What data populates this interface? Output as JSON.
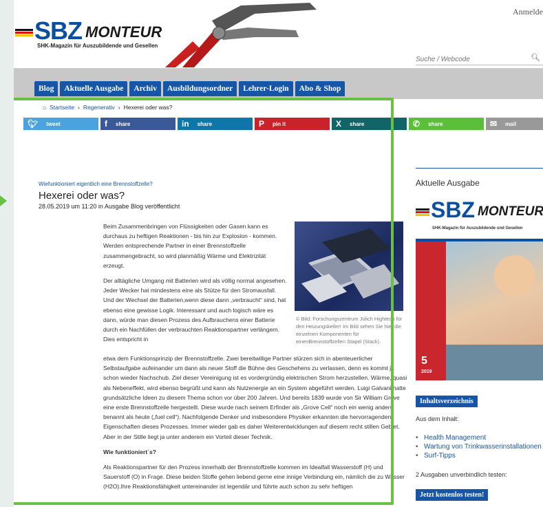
{
  "header": {
    "login": "Anmelde",
    "logo_sbz": "SBZ",
    "logo_monteur": "MONTEUR",
    "logo_tagline": "SHK-Magazin für Auszubildende und Gesellen",
    "search_placeholder": "Suche / Webcode"
  },
  "nav": [
    "Blog",
    "Aktuelle Ausgabe",
    "Archiv",
    "Ausbildungsordner",
    "Lehrer-Login",
    "Abo & Shop"
  ],
  "breadcrumb": {
    "home": "Startseite",
    "section": "Regenerativ",
    "current": "Hexerei oder was?"
  },
  "share": {
    "tweet": "tweet",
    "facebook": "share",
    "linkedin": "share",
    "pinterest": "pin it",
    "xing": "share",
    "whatsapp": "share",
    "mail": "mail",
    "colors": {
      "twitter": "#4aa3df",
      "facebook": "#3b5998",
      "linkedin": "#0e76a8",
      "pinterest": "#c9222b",
      "xing": "#126567",
      "whatsapp": "#5cbf3a",
      "mail": "#999999"
    }
  },
  "article": {
    "kicker": "Wiefunktioniert eigentlich eine Brennstoffzelle?",
    "title": "Hexerei oder was?",
    "date": "28.05.2019 um 11:20 in Ausgabe Blog veröffentlicht",
    "p1": "Beim Zusammenbringen von Flüssigkeiten oder Gasen kann es durchaus zu heftigen Reaktionen - bis hin zur Explosion - kommen. Werden entsprechende Partner in einer Brennstoffzelle zusammengebracht, so wird planmäßig Wärme und Elektrizität erzeugt.",
    "p2a": "Der alltägliche Umgang mit Batterien wird als völlig normal angesehen. Jeder Wecker hat mindestens eine als Stütze für den Stromausfall. Und der Wechsel der Batterien,wenn diese dann „verbraucht“ sind, hat ebenso eine gewisse Logik. Interessant und auch logisch wäre es dann, würde man diesen Prozess des Aufbrauchens einer Batterie durch ein Nachfüllen der verbrauchten Reaktionspartner verlängern. Dies entspricht in",
    "p2b": "etwa dem Funktionsprinzip der Brennstoffzelle. Zwei bereitwillige Partner stürzen sich in abenteuerlicher Selbstaufgabe aufeinander um dann als neuer Stoff die Bühne des Geschehens zu verlassen, denn es kommt ja schon wieder Nachschub. Ziel dieser Vereinigung ist es vordergründig elektrischen Strom herzustellen. Wärme, quasi als Nebeneffekt, wird ebenso begrüßt und kann als Nutzenergie an ein System abgeführt werden. Luigi Galvani hatte grundsätzliche Ideen zu diesem Thema schon vor über 200 Jahren. Und bereits 1839 wurde von Sir William Grove eine erste Brennstoffzelle hergestellt. Diese wurde nach seinem Erfinder als „Grove Cell“ noch ein wenig anders benannt als heute („fuel cell“). Nachfolgende Denker und insbesondere Physiker erkannten die hervorragenden Eigenschaften dieses Prozesses. Immer wieder gab es daher Weiterentwicklungen auf diesem recht stillen Gebiet. Aber in der Stille liegt ja unter anderem ein Vorteil dieser Technik.",
    "subheading": "Wie funktioniert´s?",
    "p3": "Als Reaktionspartner für den Prozess innerhalb der Brennstoffzelle kommen im Idealfall Wasserstoff (H) und Sauerstoff (O) in Frage. Diese beiden Stoffe gehen liebend gerne eine innige Verbindung ein, nämlich die zu Wasser (H2O).Ihre Reaktionsfähigkeit untereinander ist legendär und führte auch schon zu sehr heftigen",
    "caption": "© Bild: Forschungszentrum Jülich Hightech für den Heizungskeller! Im Bild sehen Sie hier die einzelnen Komponenten für einenBrennstoffzellen Stapel (Stack)."
  },
  "sidebar": {
    "heading": "Aktuelle Ausgabe",
    "cover_sbz": "SBZ",
    "cover_monteur": "MONTEUR",
    "cover_tagline": "SHK-Magazin für Auszubildende und Gesellen",
    "cover_issue": "5",
    "cover_year": "2019",
    "toc_button": "Inhaltsverzeichnis",
    "from_content": "Aus dem Inhalt:",
    "items": [
      "Health Management",
      "Wartung von Trinkwasserinstallationen",
      "Surf-Tipps"
    ],
    "trial_text": "2 Ausgaben unverbindlich testen:",
    "trial_button": "Jetzt kostenlos testen!"
  }
}
